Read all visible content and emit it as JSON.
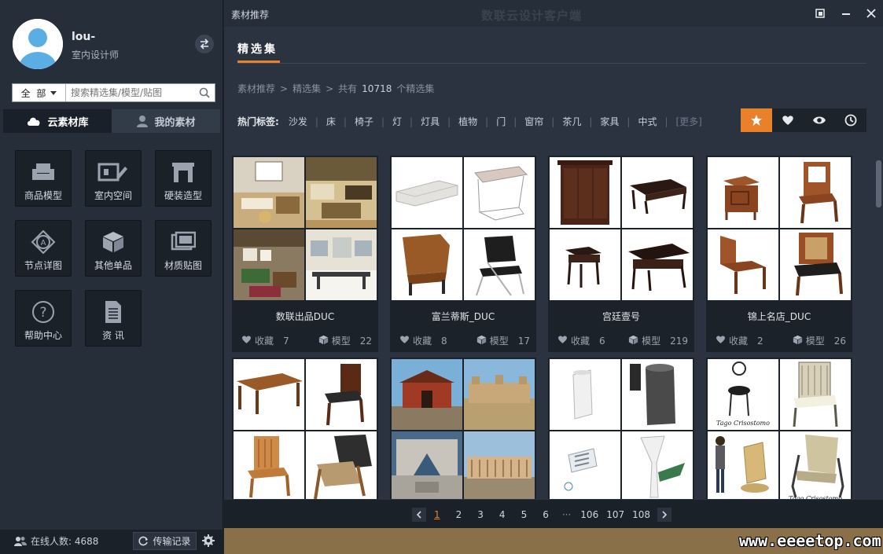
{
  "app_title": "数联云设计客户端",
  "user": {
    "name": "lou-",
    "role": "室内设计师"
  },
  "search": {
    "scope": "全 部",
    "placeholder": "搜索精选集/模型/贴图"
  },
  "left_tabs": [
    {
      "label": "云素材库",
      "active": true
    },
    {
      "label": "我的素材",
      "active": false
    }
  ],
  "categories": [
    {
      "label": "商品模型",
      "icon": "sofa-icon"
    },
    {
      "label": "室内空间",
      "icon": "room-icon"
    },
    {
      "label": "硬装造型",
      "icon": "fireplace-icon"
    },
    {
      "label": "节点详图",
      "icon": "node-detail-icon"
    },
    {
      "label": "其他单品",
      "icon": "cube-icon"
    },
    {
      "label": "材质贴图",
      "icon": "texture-icon"
    },
    {
      "label": "帮助中心",
      "icon": "help-icon"
    },
    {
      "label": "资 讯",
      "icon": "document-icon"
    }
  ],
  "footer_left": {
    "online": "在线人数: 4688",
    "transfer": "传输记录"
  },
  "titlebar": {
    "title": "素材推荐"
  },
  "main_tab": "精选集",
  "breadcrumb": {
    "root": "素材推荐",
    "sep1": ">",
    "current": "精选集",
    "sep2": ">",
    "prefix": "共有",
    "count": "10718",
    "suffix": "个精选集"
  },
  "hot_tags": {
    "label": "热门标签:",
    "items": [
      "沙发",
      "床",
      "椅子",
      "灯",
      "灯具",
      "植物",
      "门",
      "窗帘",
      "茶几",
      "家具",
      "中式"
    ],
    "more": "[更多]"
  },
  "sort_buttons": [
    {
      "icon": "star-icon",
      "active": true
    },
    {
      "icon": "heart-icon",
      "active": false
    },
    {
      "icon": "eye-icon",
      "active": false
    },
    {
      "icon": "clock-icon",
      "active": false
    }
  ],
  "cards": [
    {
      "name": "数联出品DUC",
      "fav_label": "收藏",
      "favorites": "7",
      "model_label": "模型",
      "models": "22"
    },
    {
      "name": "富兰蒂斯_DUC",
      "fav_label": "收藏",
      "favorites": "8",
      "model_label": "模型",
      "models": "17"
    },
    {
      "name": "宫廷壹号",
      "fav_label": "收藏",
      "favorites": "6",
      "model_label": "模型",
      "models": "219"
    },
    {
      "name": "锦上名店_DUC",
      "fav_label": "收藏",
      "favorites": "2",
      "model_label": "模型",
      "models": "26"
    },
    {
      "name": "",
      "fav_label": "",
      "favorites": "",
      "model_label": "",
      "models": ""
    },
    {
      "name": "",
      "fav_label": "",
      "favorites": "",
      "model_label": "",
      "models": ""
    },
    {
      "name": "",
      "fav_label": "",
      "favorites": "",
      "model_label": "",
      "models": ""
    },
    {
      "name": "",
      "fav_label": "",
      "favorites": "",
      "model_label": "",
      "models": ""
    }
  ],
  "pagination": {
    "pages": [
      "1",
      "2",
      "3",
      "4",
      "5",
      "6"
    ],
    "ellipsis": "···",
    "tail": [
      "106",
      "107",
      "108"
    ],
    "current": "1"
  },
  "watermark": "www.eeeetop.com",
  "colors": {
    "accent": "#e8812a",
    "panel": "#262e39",
    "content": "#2b3340"
  }
}
